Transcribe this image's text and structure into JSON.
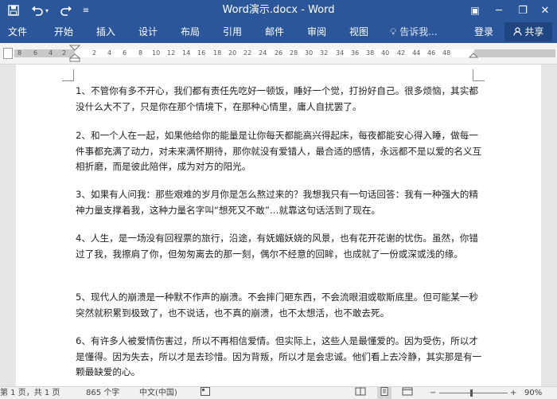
{
  "window": {
    "title": "Word演示.docx - Word",
    "minimize": "─",
    "restore": "❐",
    "close": "✕"
  },
  "quick_access": {
    "save_icon": "save-icon",
    "undo_icon": "undo-icon",
    "redo_icon": "redo-icon",
    "customize_icon": "customize-icon"
  },
  "ribbon": {
    "tabs": [
      "文件",
      "开始",
      "插入",
      "设计",
      "布局",
      "引用",
      "邮件",
      "审阅",
      "视图"
    ],
    "tell_me": "告诉我...",
    "login": "登录",
    "share": "共享"
  },
  "ruler": {
    "labels": [
      "8",
      "6",
      "4",
      "2",
      "2",
      "4",
      "6",
      "8",
      "10",
      "12",
      "14",
      "16",
      "18",
      "20",
      "22",
      "24",
      "26",
      "28",
      "30",
      "32",
      "34",
      "36",
      "38",
      "40",
      "42",
      "44",
      "46",
      "48"
    ]
  },
  "document": {
    "paragraphs": [
      "1、不管你有多不开心，我们都有责任先吃好一顿饭，睡好一个觉，打扮好自己。很多烦恼，其实都没什么大不了，只是你在那个情境下，在那种心情里，庸人自扰罢了。",
      "2、和一个人在一起，如果他给你的能量是让你每天都能高兴得起床，每夜都能安心得入睡，做每一件事都充满了动力，对未来满怀期待，那你就没有爱错人，最合适的感情，永远都不是以爱的名义互相折磨，而是彼此陪伴，成为对方的阳光。",
      "3、如果有人问我：那些艰难的岁月你是怎么熬过来的？我想我只有一句话回答：我有一种强大的精神力量支撑着我，这种力量名字叫“想死又不敢”…就靠这句话活到了现在。",
      "4、人生，是一场没有回程票的旅行，沿途，有妩媚妖娆的风景，也有花开花谢的忧伤。虽然，你错过了我，我擦肩了你，但匆匆离去的那一刻，偶尔不经意的回眸，也成就了一份或深或浅的缘。",
      "5、现代人的崩溃是一种默不作声的崩溃。不会摔门砸东西，不会流眼泪或歇斯底里。但可能某一秒突然就积累到极致了，也不说话，也不真的崩溃，也不太想活，也不敢去死。",
      "6、有许多人被爱情伤害过，所以不再相信爱情。但实际上，这些人是最懂爱的。因为受伤，所以才是懂得。因为失去，所以才是去珍惜。因为背叛，所以才是会忠诚。他们看上去冷静，其实那是有一颗最缺爱的心。"
    ]
  },
  "status": {
    "page": "第 1 页，共 1 页",
    "words": "865 个字",
    "language": "中文(中国)",
    "zoom_minus": "−",
    "zoom_plus": "+",
    "zoom": "90%"
  }
}
